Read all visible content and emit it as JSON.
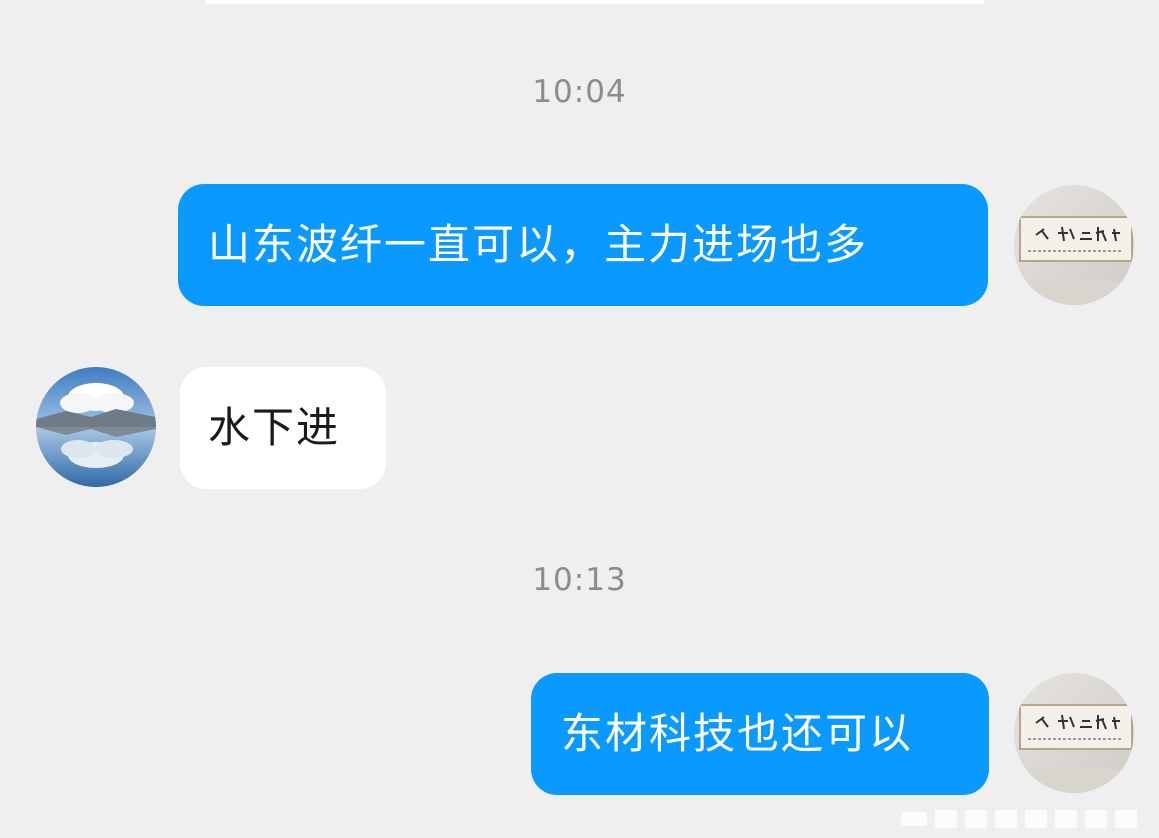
{
  "chat": {
    "timestamps": [
      "10:04",
      "10:13"
    ],
    "messages": [
      {
        "direction": "out",
        "text": "山东波纤一直可以，主力进场也多"
      },
      {
        "direction": "in",
        "text": "水下进"
      },
      {
        "direction": "out",
        "text": "东材科技也还可以"
      }
    ]
  },
  "avatars": {
    "self": "calligraphy-scroll-photo",
    "other": "mountain-lake-cloud-reflection-photo"
  },
  "colors": {
    "background": "#efefef",
    "outgoing_bubble": "#0a99ff",
    "incoming_bubble": "#ffffff",
    "timestamp_text": "#8c8c8c"
  }
}
